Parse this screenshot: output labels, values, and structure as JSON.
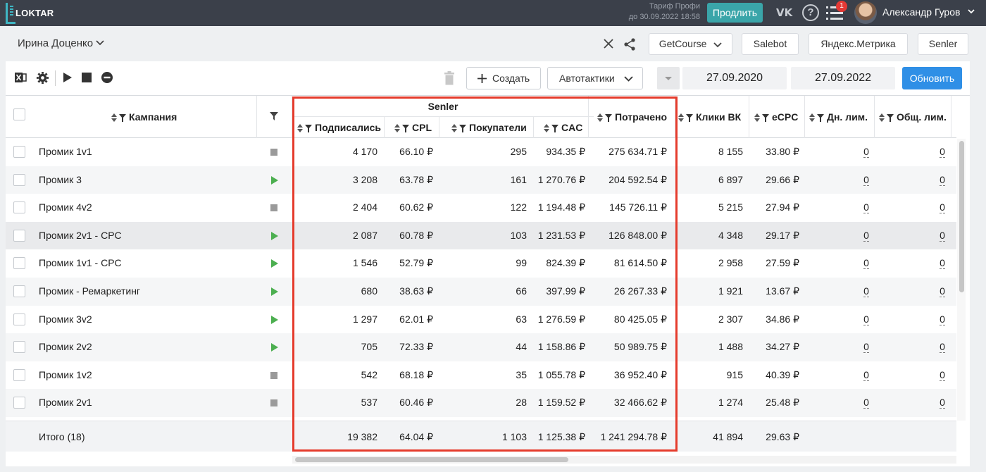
{
  "topbar": {
    "logo": "LOKTAR",
    "tariff_line1": "Тариф Профи",
    "tariff_line2": "до 30.09.2022 18:58",
    "renew_label": "Продлить",
    "vk_icon": "VK",
    "help_icon": "?",
    "notification_count": "1",
    "user_name": "Александр Гуров"
  },
  "projectbar": {
    "project_name": "Ирина Доценко",
    "integrations": [
      "GetCourse",
      "Salebot",
      "Яндекс.Метрика",
      "Senler"
    ]
  },
  "toolbar": {
    "create_label": "Создать",
    "autotactics_label": "Автотактики",
    "date_from": "27.09.2020",
    "date_to": "27.09.2022",
    "update_label": "Обновить"
  },
  "table": {
    "group_header": "Senler",
    "headers": {
      "campaign": "Кампания",
      "subscribed": "Подписались",
      "cpl": "CPL",
      "buyers": "Покупатели",
      "cac": "CAC",
      "spent": "Потрачено",
      "clicks_vk": "Клики ВК",
      "ecpc": "eCPC",
      "day_limit": "Дн. лим.",
      "total_limit": "Общ. лим."
    },
    "rows": [
      {
        "name": "Промик 1v1",
        "status": "stopped",
        "subscribed": "4 170",
        "cpl": "66.10 ₽",
        "buyers": "295",
        "cac": "934.35 ₽",
        "spent": "275 634.71 ₽",
        "clicks": "8 155",
        "ecpc": "33.80 ₽",
        "day_limit": "0",
        "total_limit": "0"
      },
      {
        "name": "Промик 3",
        "status": "running",
        "subscribed": "3 208",
        "cpl": "63.78 ₽",
        "buyers": "161",
        "cac": "1 270.76 ₽",
        "spent": "204 592.54 ₽",
        "clicks": "6 897",
        "ecpc": "29.66 ₽",
        "day_limit": "0",
        "total_limit": "0"
      },
      {
        "name": "Промик 4v2",
        "status": "stopped",
        "subscribed": "2 404",
        "cpl": "60.62 ₽",
        "buyers": "122",
        "cac": "1 194.48 ₽",
        "spent": "145 726.11 ₽",
        "clicks": "5 215",
        "ecpc": "27.94 ₽",
        "day_limit": "0",
        "total_limit": "0"
      },
      {
        "name": "Промик 2v1 - CPC",
        "status": "running",
        "subscribed": "2 087",
        "cpl": "60.78 ₽",
        "buyers": "103",
        "cac": "1 231.53 ₽",
        "spent": "126 848.00 ₽",
        "clicks": "4 348",
        "ecpc": "29.17 ₽",
        "day_limit": "0",
        "total_limit": "0"
      },
      {
        "name": "Промик 1v1 - CPC",
        "status": "running",
        "subscribed": "1 546",
        "cpl": "52.79 ₽",
        "buyers": "99",
        "cac": "824.39 ₽",
        "spent": "81 614.50 ₽",
        "clicks": "2 958",
        "ecpc": "27.59 ₽",
        "day_limit": "0",
        "total_limit": "0"
      },
      {
        "name": "Промик - Ремаркетинг",
        "status": "running",
        "subscribed": "680",
        "cpl": "38.63 ₽",
        "buyers": "66",
        "cac": "397.99 ₽",
        "spent": "26 267.33 ₽",
        "clicks": "1 921",
        "ecpc": "13.67 ₽",
        "day_limit": "0",
        "total_limit": "0"
      },
      {
        "name": "Промик 3v2",
        "status": "running",
        "subscribed": "1 297",
        "cpl": "62.01 ₽",
        "buyers": "63",
        "cac": "1 276.59 ₽",
        "spent": "80 425.05 ₽",
        "clicks": "2 307",
        "ecpc": "34.86 ₽",
        "day_limit": "0",
        "total_limit": "0"
      },
      {
        "name": "Промик 2v2",
        "status": "running",
        "subscribed": "705",
        "cpl": "72.33 ₽",
        "buyers": "44",
        "cac": "1 158.86 ₽",
        "spent": "50 989.75 ₽",
        "clicks": "1 488",
        "ecpc": "34.27 ₽",
        "day_limit": "0",
        "total_limit": "0"
      },
      {
        "name": "Промик 1v2",
        "status": "stopped",
        "subscribed": "542",
        "cpl": "68.18 ₽",
        "buyers": "35",
        "cac": "1 055.78 ₽",
        "spent": "36 952.40 ₽",
        "clicks": "915",
        "ecpc": "40.39 ₽",
        "day_limit": "0",
        "total_limit": "0"
      },
      {
        "name": "Промик 2v1",
        "status": "stopped",
        "subscribed": "537",
        "cpl": "60.46 ₽",
        "buyers": "28",
        "cac": "1 159.52 ₽",
        "spent": "32 466.62 ₽",
        "clicks": "1 274",
        "ecpc": "25.48 ₽",
        "day_limit": "0",
        "total_limit": "0"
      }
    ],
    "totals": {
      "label": "Итого (18)",
      "subscribed": "19 382",
      "cpl": "64.04 ₽",
      "buyers": "1 103",
      "cac": "1 125.38 ₽",
      "spent": "1 241 294.78 ₽",
      "clicks": "41 894",
      "ecpc": "29.63 ₽"
    }
  },
  "colors": {
    "topbar_bg": "#3b404a",
    "renew_btn": "#3aa5a9",
    "update_btn": "#2f8fe6",
    "highlight_border": "#e53b2c",
    "status_running": "#4caf50",
    "status_stopped": "#9a9a9a"
  }
}
